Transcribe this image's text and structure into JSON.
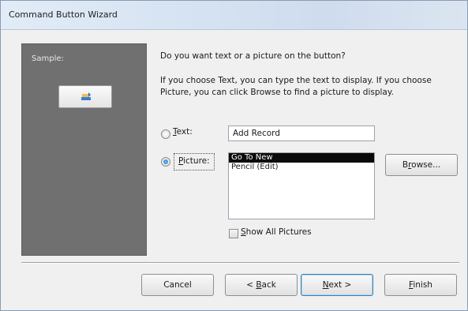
{
  "window": {
    "title": "Command Button Wizard"
  },
  "sample": {
    "label": "Sample:",
    "icon": "go-to-new-record-icon"
  },
  "prompt": {
    "question": "Do you want text or a picture on the button?",
    "explanation": "If you choose Text, you can type the text to display.  If you choose Picture, you can click Browse to find a picture to display."
  },
  "options": {
    "text": {
      "label_mnemonic": "T",
      "label_rest": "ext:",
      "selected": false,
      "value": "Add Record"
    },
    "picture": {
      "label_mnemonic": "P",
      "label_rest": "icture:",
      "selected": true
    }
  },
  "pictures": {
    "items": [
      "Go To New",
      "Pencil (Edit)"
    ],
    "selected_index": 0
  },
  "show_all": {
    "label_mnemonic": "S",
    "label_rest": "how All Pictures",
    "checked": false
  },
  "buttons": {
    "browse": {
      "pre": "B",
      "mn": "r",
      "post": "owse..."
    },
    "cancel": "Cancel",
    "back": {
      "pre": "< ",
      "mn": "B",
      "post": "ack"
    },
    "next": {
      "pre": "",
      "mn": "N",
      "post": "ext >"
    },
    "finish": {
      "pre": "",
      "mn": "F",
      "post": "inish"
    }
  }
}
